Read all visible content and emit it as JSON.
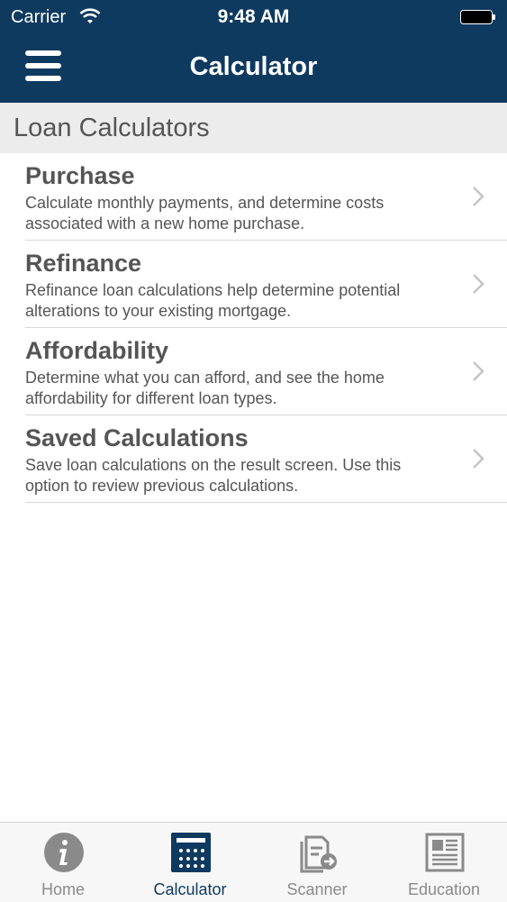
{
  "status_bar": {
    "carrier": "Carrier",
    "time": "9:48 AM"
  },
  "header": {
    "title": "Calculator"
  },
  "section": {
    "title": "Loan Calculators"
  },
  "items": [
    {
      "title": "Purchase",
      "description": "Calculate monthly payments, and determine costs associated with a new home purchase."
    },
    {
      "title": "Refinance",
      "description": "Refinance loan calculations help determine potential alterations to your existing mortgage."
    },
    {
      "title": "Affordability",
      "description": "Determine what you can afford, and see the home affordability for different loan types."
    },
    {
      "title": "Saved Calculations",
      "description": "Save loan calculations on the result screen. Use this option to review previous calculations."
    }
  ],
  "tabs": [
    {
      "label": "Home",
      "icon": "info-icon"
    },
    {
      "label": "Calculator",
      "icon": "calculator-icon"
    },
    {
      "label": "Scanner",
      "icon": "scanner-icon"
    },
    {
      "label": "Education",
      "icon": "newspaper-icon"
    }
  ],
  "active_tab": "Calculator",
  "colors": {
    "header_bg": "#0f3a60",
    "section_bg": "#ececec",
    "text": "#555555",
    "tab_inactive": "#8a8a8a"
  }
}
